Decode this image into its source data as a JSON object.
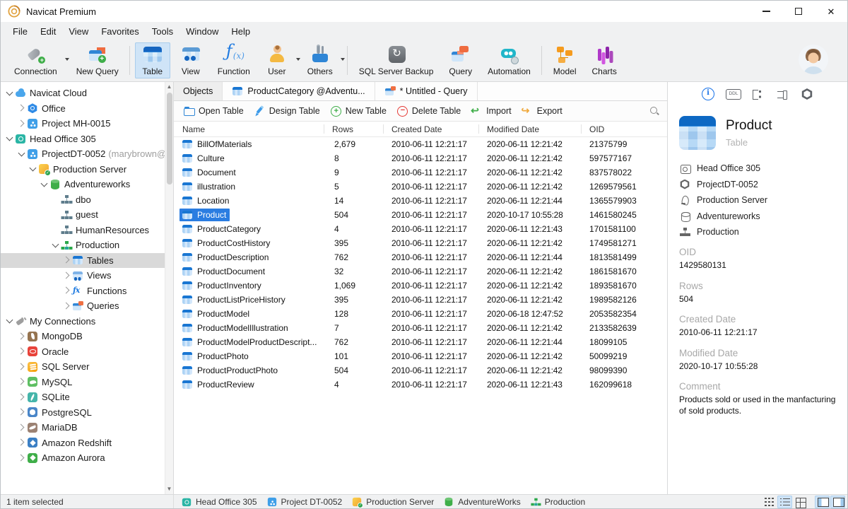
{
  "window": {
    "title": "Navicat Premium"
  },
  "menu": {
    "items": [
      {
        "label": "File"
      },
      {
        "label": "Edit"
      },
      {
        "label": "View"
      },
      {
        "label": "Favorites"
      },
      {
        "label": "Tools"
      },
      {
        "label": "Window"
      },
      {
        "label": "Help"
      }
    ]
  },
  "toolbar": {
    "buttons": [
      {
        "label": "Connection",
        "icon": "connection-icon",
        "cls": "dd"
      },
      {
        "label": "New Query",
        "icon": "new-query-icon"
      },
      {
        "label": "Table",
        "icon": "table-icon",
        "cls": "active grp"
      },
      {
        "label": "View",
        "icon": "view-icon"
      },
      {
        "label": "Function",
        "icon": "function-icon"
      },
      {
        "label": "User",
        "icon": "user-icon",
        "cls": "dd"
      },
      {
        "label": "Others",
        "icon": "others-icon",
        "cls": "dd"
      },
      {
        "label": "SQL Server Backup",
        "icon": "sql-server-backup-icon",
        "cls": "grp"
      },
      {
        "label": "Query",
        "icon": "query-icon"
      },
      {
        "label": "Automation",
        "icon": "automation-icon"
      },
      {
        "label": "Model",
        "icon": "model-icon",
        "cls": "grp"
      },
      {
        "label": "Charts",
        "icon": "charts-icon"
      }
    ]
  },
  "sidebar": {
    "items": [
      {
        "label": "Navicat Cloud",
        "icon": "cloud-icon",
        "arrow": "d",
        "ind": 0
      },
      {
        "label": "Office",
        "icon": "office-icon",
        "arrow": "r",
        "ind": 1
      },
      {
        "label": "Project MH-0015",
        "icon": "project-icon",
        "arrow": "r",
        "ind": 1
      },
      {
        "label": "Head Office 305",
        "icon": "head-office-icon",
        "arrow": "d",
        "ind": 0
      },
      {
        "label": "ProjectDT-0052",
        "suffix": "(marybrown@",
        "icon": "project-icon",
        "arrow": "d",
        "ind": 1
      },
      {
        "label": "Production Server",
        "icon": "server-icon",
        "arrow": "d",
        "ind": 2
      },
      {
        "label": "Adventureworks",
        "icon": "database-icon",
        "arrow": "d",
        "ind": 3
      },
      {
        "label": "dbo",
        "icon": "schema-icon",
        "arrow": "n",
        "ind": 4
      },
      {
        "label": "guest",
        "icon": "schema-icon",
        "arrow": "n",
        "ind": 4
      },
      {
        "label": "HumanResources",
        "icon": "schema-icon",
        "arrow": "n",
        "ind": 4
      },
      {
        "label": "Production",
        "icon": "schema-green-icon",
        "arrow": "d",
        "ind": 4
      },
      {
        "label": "Tables",
        "icon": "tables-icon",
        "arrow": "r",
        "ind": 5,
        "cls": "sel"
      },
      {
        "label": "Views",
        "icon": "views-icon",
        "arrow": "r",
        "ind": 5
      },
      {
        "label": "Functions",
        "icon": "functions-icon",
        "arrow": "r",
        "ind": 5
      },
      {
        "label": "Queries",
        "icon": "queries-icon",
        "arrow": "r",
        "ind": 5
      },
      {
        "label": "My Connections",
        "icon": "connections-icon",
        "arrow": "d",
        "ind": 0
      },
      {
        "label": "MongoDB",
        "icon": "mongodb-icon",
        "arrow": "r",
        "ind": 1
      },
      {
        "label": "Oracle",
        "icon": "oracle-icon",
        "arrow": "r",
        "ind": 1
      },
      {
        "label": "SQL Server",
        "icon": "sqlserver-icon",
        "arrow": "r",
        "ind": 1
      },
      {
        "label": "MySQL",
        "icon": "mysql-icon",
        "arrow": "r",
        "ind": 1
      },
      {
        "label": "SQLite",
        "icon": "sqlite-icon",
        "arrow": "r",
        "ind": 1
      },
      {
        "label": "PostgreSQL",
        "icon": "postgresql-icon",
        "arrow": "r",
        "ind": 1
      },
      {
        "label": "MariaDB",
        "icon": "mariadb-icon",
        "arrow": "r",
        "ind": 1
      },
      {
        "label": "Amazon Redshift",
        "icon": "redshift-icon",
        "arrow": "r",
        "ind": 1
      },
      {
        "label": "Amazon Aurora",
        "icon": "aurora-icon",
        "arrow": "r",
        "ind": 1
      }
    ]
  },
  "tabs": {
    "items": [
      {
        "label": "Objects",
        "cls": "active"
      },
      {
        "label": "ProductCategory @Adventu...",
        "icon": "tables-icon"
      },
      {
        "label": "* Untitled - Query",
        "icon": "queries-icon"
      }
    ]
  },
  "objects_toolbar": {
    "buttons": [
      {
        "label": "Open Table",
        "icon": "open-table-icon"
      },
      {
        "label": "Design Table",
        "icon": "design-table-icon"
      },
      {
        "label": "New Table",
        "icon": "new-table-icon"
      },
      {
        "label": "Delete Table",
        "icon": "delete-table-icon"
      },
      {
        "label": "Import",
        "icon": "import-icon"
      },
      {
        "label": "Export",
        "icon": "export-icon"
      }
    ]
  },
  "grid": {
    "columns": [
      {
        "label": "Name"
      },
      {
        "label": "Rows"
      },
      {
        "label": "Created Date"
      },
      {
        "label": "Modified Date"
      },
      {
        "label": "OID"
      }
    ],
    "rows": [
      {
        "name": "BillOfMaterials",
        "rows": "2,679",
        "created": "2010-06-11 12:21:17",
        "modified": "2020-06-11 12:21:42",
        "oid": "21375799"
      },
      {
        "name": "Culture",
        "rows": "8",
        "created": "2010-06-11 12:21:17",
        "modified": "2020-06-11 12:21:42",
        "oid": "597577167"
      },
      {
        "name": "Document",
        "rows": "9",
        "created": "2010-06-11 12:21:17",
        "modified": "2020-06-11 12:21:42",
        "oid": "837578022"
      },
      {
        "name": "illustration",
        "rows": "5",
        "created": "2010-06-11 12:21:17",
        "modified": "2020-06-11 12:21:42",
        "oid": "1269579561"
      },
      {
        "name": "Location",
        "rows": "14",
        "created": "2010-06-11 12:21:17",
        "modified": "2020-06-11 12:21:44",
        "oid": "1365579903"
      },
      {
        "name": "Product",
        "rows": "504",
        "created": "2010-06-11 12:21:17",
        "modified": "2020-10-17 10:55:28",
        "oid": "1461580245",
        "cls": "sel"
      },
      {
        "name": "ProductCategory",
        "rows": "4",
        "created": "2010-06-11 12:21:17",
        "modified": "2020-06-11 12:21:43",
        "oid": "1701581100"
      },
      {
        "name": "ProductCostHistory",
        "rows": "395",
        "created": "2010-06-11 12:21:17",
        "modified": "2020-06-11 12:21:42",
        "oid": "1749581271"
      },
      {
        "name": "ProductDescription",
        "rows": "762",
        "created": "2010-06-11 12:21:17",
        "modified": "2020-06-11 12:21:44",
        "oid": "1813581499"
      },
      {
        "name": "ProductDocument",
        "rows": "32",
        "created": "2010-06-11 12:21:17",
        "modified": "2020-06-11 12:21:42",
        "oid": "1861581670"
      },
      {
        "name": "ProductInventory",
        "rows": "1,069",
        "created": "2010-06-11 12:21:17",
        "modified": "2020-06-11 12:21:42",
        "oid": "1893581670"
      },
      {
        "name": "ProductListPriceHistory",
        "rows": "395",
        "created": "2010-06-11 12:21:17",
        "modified": "2020-06-11 12:21:42",
        "oid": "1989582126"
      },
      {
        "name": "ProductModel",
        "rows": "128",
        "created": "2010-06-11 12:21:17",
        "modified": "2020-06-18 12:47:52",
        "oid": "2053582354"
      },
      {
        "name": "ProductModelIllustration",
        "rows": "7",
        "created": "2010-06-11 12:21:17",
        "modified": "2020-06-11 12:21:42",
        "oid": "2133582639"
      },
      {
        "name": "ProductModelProductDescript...",
        "rows": "762",
        "created": "2010-06-11 12:21:17",
        "modified": "2020-06-11 12:21:44",
        "oid": "18099105"
      },
      {
        "name": "ProductPhoto",
        "rows": "101",
        "created": "2010-06-11 12:21:17",
        "modified": "2020-06-11 12:21:42",
        "oid": "50099219"
      },
      {
        "name": "ProductProductPhoto",
        "rows": "504",
        "created": "2010-06-11 12:21:17",
        "modified": "2020-06-11 12:21:42",
        "oid": "98099390"
      },
      {
        "name": "ProductReview",
        "rows": "4",
        "created": "2010-06-11 12:21:17",
        "modified": "2020-06-11 12:21:43",
        "oid": "162099618"
      }
    ]
  },
  "right_panel": {
    "title": "Product",
    "subtitle": "Table",
    "breadcrumbs": [
      {
        "label": "Head Office 305",
        "icon": "head-office-outline-icon"
      },
      {
        "label": "ProjectDT-0052",
        "icon": "project-outline-icon"
      },
      {
        "label": "Production Server",
        "icon": "server-outline-icon"
      },
      {
        "label": "Adventureworks",
        "icon": "database-outline-icon"
      },
      {
        "label": "Production",
        "icon": "schema-outline-icon"
      }
    ],
    "details": [
      {
        "label": "OID",
        "value": "1429580131"
      },
      {
        "label": "Rows",
        "value": "504"
      },
      {
        "label": "Created Date",
        "value": "2010-06-11 12:21:17"
      },
      {
        "label": "Modified Date",
        "value": "2020-10-17 10:55:28"
      },
      {
        "label": "Comment",
        "value": "Products sold or used in the manfacturing of sold products."
      }
    ]
  },
  "statusbar": {
    "selection": "1 item selected",
    "path": [
      {
        "label": "Head Office 305",
        "icon": "head-office-icon"
      },
      {
        "label": "Project DT-0052",
        "icon": "project-icon"
      },
      {
        "label": "Production Server",
        "icon": "server-icon"
      },
      {
        "label": "AdventureWorks",
        "icon": "database-icon"
      },
      {
        "label": "Production",
        "icon": "schema-green-icon"
      }
    ]
  }
}
